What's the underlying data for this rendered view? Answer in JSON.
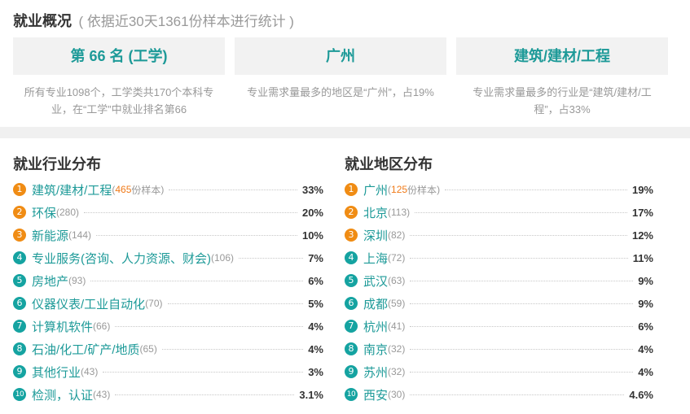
{
  "overview": {
    "title": "就业概况",
    "subtitle": "( 依据近30天1361份样本进行统计 )",
    "cards": [
      {
        "value": "第 66 名 (工学)",
        "desc_line1": "所有专业1098个，工学类共170个本科专",
        "desc_line2": "业，在“工学”中就业排名第66"
      },
      {
        "value": "广州",
        "desc_line1": "专业需求量最多的地区是“广州”，占19%",
        "desc_line2": ""
      },
      {
        "value": "建筑/建材/工程",
        "desc_line1": "专业需求量最多的行业是“建筑/建材/工",
        "desc_line2": "程”，占33%"
      }
    ]
  },
  "industry": {
    "title": "就业行业分布",
    "sample_unit": "份样本",
    "items": [
      {
        "rank": "1",
        "name": "建筑/建材/工程",
        "count": "465",
        "pct": "33%"
      },
      {
        "rank": "2",
        "name": "环保",
        "count": "(280)",
        "pct": "20%"
      },
      {
        "rank": "3",
        "name": "新能源",
        "count": "(144)",
        "pct": "10%"
      },
      {
        "rank": "4",
        "name": "专业服务(咨询、人力资源、财会)",
        "count": "(106)",
        "pct": "7%"
      },
      {
        "rank": "5",
        "name": "房地产",
        "count": "(93)",
        "pct": "6%"
      },
      {
        "rank": "6",
        "name": "仪器仪表/工业自动化",
        "count": "(70)",
        "pct": "5%"
      },
      {
        "rank": "7",
        "name": "计算机软件",
        "count": "(66)",
        "pct": "4%"
      },
      {
        "rank": "8",
        "name": "石油/化工/矿产/地质",
        "count": "(65)",
        "pct": "4%"
      },
      {
        "rank": "9",
        "name": "其他行业",
        "count": "(43)",
        "pct": "3%"
      },
      {
        "rank": "10",
        "name": "检测，认证",
        "count": "(43)",
        "pct": "3.1%"
      }
    ]
  },
  "region": {
    "title": "就业地区分布",
    "sample_unit": "份样本",
    "items": [
      {
        "rank": "1",
        "name": "广州",
        "count": "125",
        "pct": "19%"
      },
      {
        "rank": "2",
        "name": "北京",
        "count": "(113)",
        "pct": "17%"
      },
      {
        "rank": "3",
        "name": "深圳",
        "count": "(82)",
        "pct": "12%"
      },
      {
        "rank": "4",
        "name": "上海",
        "count": "(72)",
        "pct": "11%"
      },
      {
        "rank": "5",
        "name": "武汉",
        "count": "(63)",
        "pct": "9%"
      },
      {
        "rank": "6",
        "name": "成都",
        "count": "(59)",
        "pct": "9%"
      },
      {
        "rank": "7",
        "name": "杭州",
        "count": "(41)",
        "pct": "6%"
      },
      {
        "rank": "8",
        "name": "南京",
        "count": "(32)",
        "pct": "4%"
      },
      {
        "rank": "9",
        "name": "苏州",
        "count": "(32)",
        "pct": "4%"
      },
      {
        "rank": "10",
        "name": "西安",
        "count": "(30)",
        "pct": "4.6%"
      }
    ]
  },
  "colors": {
    "accent": "#1d9a98",
    "badge_top": "#f08c14",
    "badge_rest": "#15a3a1",
    "highlight": "#f07a18"
  }
}
